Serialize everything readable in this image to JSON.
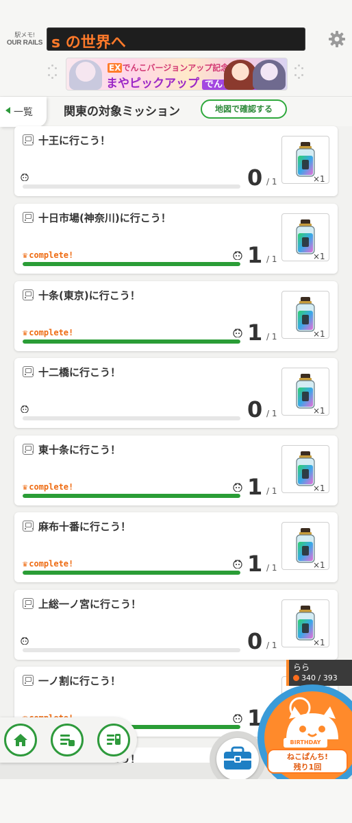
{
  "header": {
    "logo_line1": "駅メモ!",
    "logo_line2": "OUR RAILS",
    "ticker_text": "s の世界へ",
    "banner_line1_badge": "EX",
    "banner_line1": "でんこバージョンアップ記念!",
    "banner_line2": "まやピックアップ",
    "banner_line2_tag": "でんこガチャ"
  },
  "tabrow": {
    "back_label": "一覧",
    "title": "関東の対象ミッション",
    "map_button": "地図で確認する"
  },
  "missions": [
    {
      "title": "十王に行こう！",
      "complete": "",
      "count": "0",
      "total": "/ 1",
      "progress": 0,
      "reward_qty": "×1"
    },
    {
      "title": "十日市場(神奈川)に行こう！",
      "complete": "complete!",
      "count": "1",
      "total": "/ 1",
      "progress": 1,
      "reward_qty": "×1"
    },
    {
      "title": "十条(東京)に行こう！",
      "complete": "complete!",
      "count": "1",
      "total": "/ 1",
      "progress": 1,
      "reward_qty": "×1"
    },
    {
      "title": "十二橋に行こう！",
      "complete": "",
      "count": "0",
      "total": "/ 1",
      "progress": 0,
      "reward_qty": "×1"
    },
    {
      "title": "東十条に行こう！",
      "complete": "complete!",
      "count": "1",
      "total": "/ 1",
      "progress": 1,
      "reward_qty": "×1"
    },
    {
      "title": "麻布十番に行こう！",
      "complete": "complete!",
      "count": "1",
      "total": "/ 1",
      "progress": 1,
      "reward_qty": "×1"
    },
    {
      "title": "上総一ノ宮に行こう！",
      "complete": "",
      "count": "0",
      "total": "/ 1",
      "progress": 0,
      "reward_qty": "×1"
    },
    {
      "title": "一ノ割に行こう！",
      "complete": "complete!",
      "count": "1",
      "total": "/ 1",
      "progress": 1,
      "reward_qty": ""
    }
  ],
  "peek_text": "こう！",
  "user": {
    "name": "らら",
    "hp": "340 / 393"
  },
  "neko": {
    "birthday": "BIRTHDAY",
    "label_line1": "ねこぱんち!",
    "label_line2": "残り1回"
  },
  "colors": {
    "accent_green": "#2a9d36",
    "complete_orange": "#ee6b12",
    "neko_orange": "#ff8a2b",
    "neko_ring_blue": "#3a9bd8"
  },
  "icons": {
    "dock": [
      "home-icon",
      "train-list-icon",
      "train-station-icon"
    ],
    "bag": "briefcase-icon",
    "settings": "gear-icon"
  }
}
